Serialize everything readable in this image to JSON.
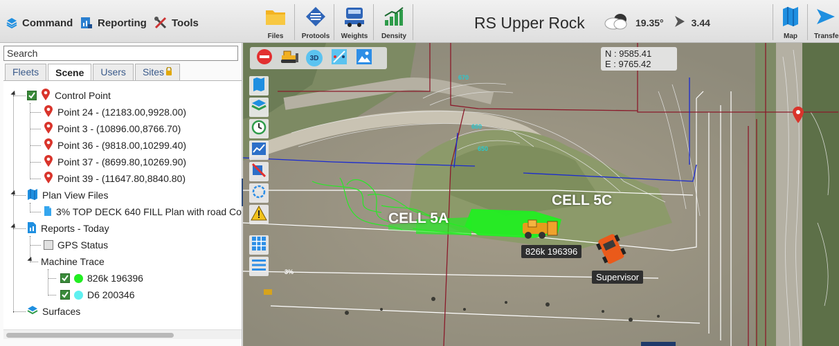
{
  "menu": {
    "command": "Command",
    "reporting": "Reporting",
    "tools": "Tools"
  },
  "toolbar": {
    "files": "Files",
    "protools": "Protools",
    "weights": "Weights",
    "density": "Density",
    "map": "Map",
    "transfer": "Transfe"
  },
  "site_title": "RS Upper Rock",
  "weather": {
    "icon": "cloud-icon",
    "temperature": "19.35°",
    "wind_icon": "wind-direction-icon",
    "wind_speed": "3.44"
  },
  "search": {
    "placeholder": "Search",
    "value": ""
  },
  "tabs": [
    {
      "label": "Fleets",
      "active": false
    },
    {
      "label": "Scene",
      "active": true
    },
    {
      "label": "Users",
      "active": false
    },
    {
      "label": "Sites",
      "active": false,
      "icon": "lock-icon"
    }
  ],
  "tree": {
    "control_point": {
      "label": "Control Point",
      "checked": true,
      "points": [
        "Point 24 - (12183.00,9928.00)",
        "Point 3 - (10896.00,8766.70)",
        "Point 36 - (9818.00,10299.40)",
        "Point 37 - (8699.80,10269.90)",
        "Point 39 - (11647.80,8840.80)"
      ]
    },
    "plan_view_files": {
      "label": "Plan View Files",
      "files": [
        "3% TOP DECK 640 FILL Plan with road Co"
      ]
    },
    "reports": {
      "label": "Reports - Today",
      "gps_status": "GPS Status",
      "machine_trace": {
        "label": "Machine Trace",
        "machines": [
          {
            "label": "826k 196396",
            "color": "#22ee22",
            "checked": true
          },
          {
            "label": "D6 200346",
            "color": "#5ff0f0",
            "checked": true
          }
        ]
      }
    },
    "surfaces": {
      "label": "Surfaces"
    }
  },
  "map": {
    "toolbar_3d": "3D",
    "coordinates": {
      "north": "N : 9585.41",
      "east": "E : 9765.42"
    },
    "cell_5a": "CELL 5A",
    "cell_5c": "CELL 5C",
    "machine_label": "826k 196396",
    "supervisor_label": "Supervisor",
    "contour_labels": [
      "670",
      "660",
      "650",
      "3%"
    ]
  },
  "colors": {
    "trace_green": "#22ee22",
    "accent_blue": "#1f8fe0",
    "pin_red": "#d9342b",
    "site_line_red": "#8a1a2a",
    "boundary_blue": "#1a2ad0"
  }
}
